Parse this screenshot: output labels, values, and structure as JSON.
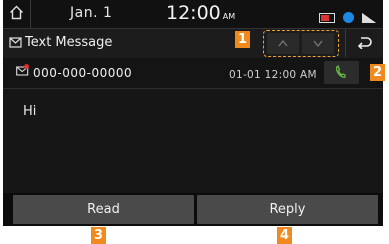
{
  "status_bar": {
    "date": "Jan.  1",
    "time": "12:00",
    "ampm": "AM",
    "icons": [
      "home-icon",
      "battery-icon",
      "bluetooth-icon",
      "signal-icon"
    ]
  },
  "title_bar": {
    "title": "Text Message",
    "title_icon": "message-icon",
    "nav_icons": [
      "chevron-up-icon",
      "chevron-down-icon"
    ],
    "back_icon": "back-arrow-icon"
  },
  "message": {
    "sender": "000-000-00000",
    "timestamp": "01-01 12:00 AM",
    "body": "Hi",
    "call_icon": "phone-icon"
  },
  "actions": {
    "read_label": "Read",
    "reply_label": "Reply"
  },
  "callouts": [
    "1",
    "2",
    "3",
    "4"
  ],
  "colors": {
    "callout": "#f08a1e",
    "button": "#4a4a4a",
    "call_icon": "#6cc04a",
    "background": "#0c0c0c"
  }
}
